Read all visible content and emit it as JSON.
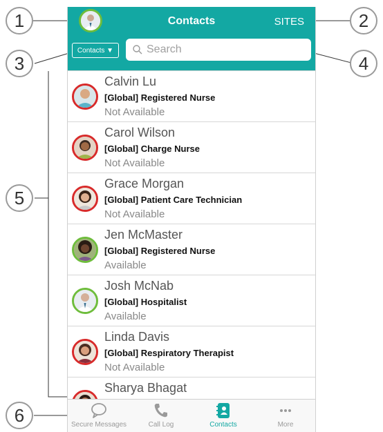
{
  "callouts": [
    "1",
    "2",
    "3",
    "4",
    "5",
    "6"
  ],
  "header": {
    "title": "Contacts",
    "sites_label": "SITES",
    "avatar_status": "available"
  },
  "filter": {
    "label": "Contacts ▼"
  },
  "search": {
    "placeholder": "Search"
  },
  "contacts": [
    {
      "name": "Calvin Lu",
      "role": "[Global] Registered Nurse",
      "status": "Not Available",
      "presence": "unavailable"
    },
    {
      "name": "Carol Wilson",
      "role": "[Global] Charge Nurse",
      "status": "Not Available",
      "presence": "unavailable"
    },
    {
      "name": "Grace Morgan",
      "role": "[Global] Patient Care Technician",
      "status": "Not Available",
      "presence": "unavailable"
    },
    {
      "name": "Jen McMaster",
      "role": "[Global] Registered Nurse",
      "status": "Available",
      "presence": "available"
    },
    {
      "name": "Josh McNab",
      "role": "[Global] Hospitalist",
      "status": "Available",
      "presence": "available"
    },
    {
      "name": "Linda Davis",
      "role": "[Global] Respiratory Therapist",
      "status": "Not Available",
      "presence": "unavailable"
    },
    {
      "name": "Sharya Bhagat",
      "role": "",
      "status": "",
      "presence": "unavailable"
    }
  ],
  "tabs": [
    {
      "label": "Secure Messages",
      "icon": "chat-bubble-icon",
      "active": false
    },
    {
      "label": "Call Log",
      "icon": "phone-icon",
      "active": false
    },
    {
      "label": "Contacts",
      "icon": "contacts-book-icon",
      "active": true
    },
    {
      "label": "More",
      "icon": "more-dots-icon",
      "active": false
    }
  ],
  "colors": {
    "accent": "#13a8a3",
    "available": "#6ebd3c",
    "unavailable": "#d82a2a"
  }
}
